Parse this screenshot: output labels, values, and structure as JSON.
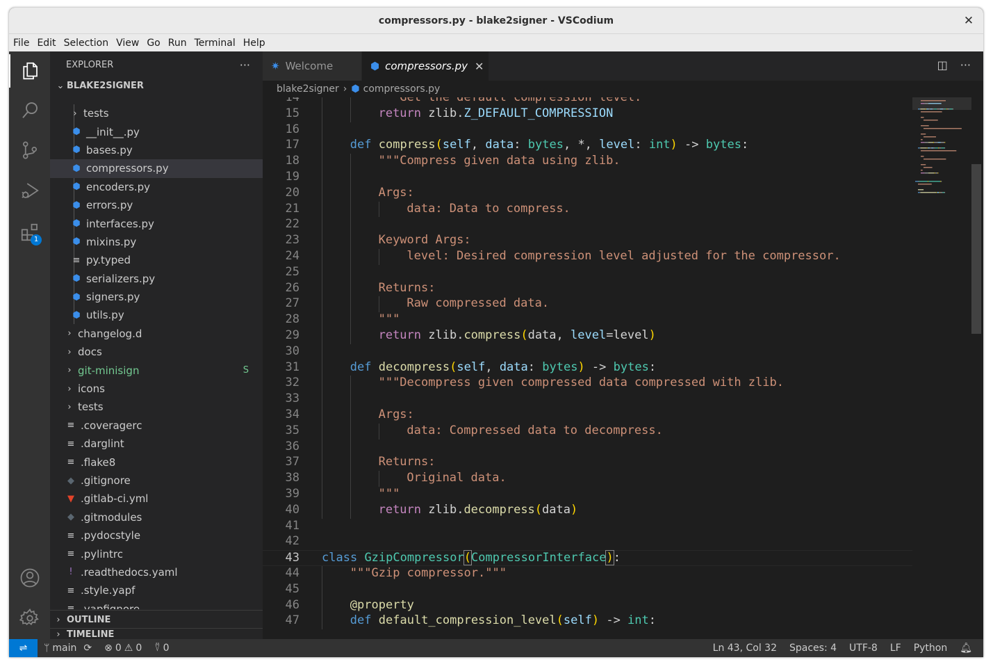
{
  "window": {
    "title": "compressors.py - blake2signer - VSCodium",
    "close_glyph": "✕"
  },
  "menu": [
    "File",
    "Edit",
    "Selection",
    "View",
    "Go",
    "Run",
    "Terminal",
    "Help"
  ],
  "activity_bar": {
    "items": [
      "explorer-icon",
      "search-icon",
      "source-control-icon",
      "run-debug-icon",
      "extensions-icon"
    ],
    "extensions_badge": "1",
    "bottom": [
      "accounts-icon",
      "settings-gear-icon"
    ]
  },
  "sidebar": {
    "header": "EXPLORER",
    "more_glyph": "···",
    "folder": "BLAKE2SIGNER",
    "tree": [
      {
        "label": "tests",
        "type": "folder",
        "indent": 1
      },
      {
        "label": "__init__.py",
        "type": "python",
        "indent": 1
      },
      {
        "label": "bases.py",
        "type": "python",
        "indent": 1
      },
      {
        "label": "compressors.py",
        "type": "python",
        "indent": 1,
        "selected": true
      },
      {
        "label": "encoders.py",
        "type": "python",
        "indent": 1
      },
      {
        "label": "errors.py",
        "type": "python",
        "indent": 1
      },
      {
        "label": "interfaces.py",
        "type": "python",
        "indent": 1
      },
      {
        "label": "mixins.py",
        "type": "python",
        "indent": 1
      },
      {
        "label": "py.typed",
        "type": "text",
        "indent": 1
      },
      {
        "label": "serializers.py",
        "type": "python",
        "indent": 1
      },
      {
        "label": "signers.py",
        "type": "python",
        "indent": 1
      },
      {
        "label": "utils.py",
        "type": "python",
        "indent": 1
      },
      {
        "label": "changelog.d",
        "type": "folder",
        "indent": 0
      },
      {
        "label": "docs",
        "type": "folder",
        "indent": 0
      },
      {
        "label": "git-minisign",
        "type": "folder",
        "indent": 0,
        "decoration": "S",
        "color": "#73c991"
      },
      {
        "label": "icons",
        "type": "folder",
        "indent": 0
      },
      {
        "label": "tests",
        "type": "folder",
        "indent": 0
      },
      {
        "label": ".coveragerc",
        "type": "text",
        "indent": 0
      },
      {
        "label": ".darglint",
        "type": "text",
        "indent": 0
      },
      {
        "label": ".flake8",
        "type": "text",
        "indent": 0
      },
      {
        "label": ".gitignore",
        "type": "git",
        "indent": 0
      },
      {
        "label": ".gitlab-ci.yml",
        "type": "gitlab",
        "indent": 0
      },
      {
        "label": ".gitmodules",
        "type": "git",
        "indent": 0
      },
      {
        "label": ".pydocstyle",
        "type": "text",
        "indent": 0
      },
      {
        "label": ".pylintrc",
        "type": "text",
        "indent": 0
      },
      {
        "label": ".readthedocs.yaml",
        "type": "yaml",
        "indent": 0
      },
      {
        "label": ".style.yapf",
        "type": "text",
        "indent": 0
      },
      {
        "label": ".yapfignore",
        "type": "text",
        "indent": 0
      }
    ],
    "sections": [
      "OUTLINE",
      "TIMELINE"
    ]
  },
  "tabs": [
    {
      "label": "Welcome",
      "active": false
    },
    {
      "label": "compressors.py",
      "active": true
    }
  ],
  "breadcrumb": [
    "blake2signer",
    "compressors.py"
  ],
  "editor": {
    "current_line": 43,
    "lines": [
      {
        "n": 14,
        "i": 2,
        "t": [
          [
            "str",
            "\"\"\"Get the default compression level.\"\"\""
          ]
        ]
      },
      {
        "n": 15,
        "i": 2,
        "t": [
          [
            "ctl",
            "return"
          ],
          [
            "pn",
            " zlib."
          ],
          [
            "param",
            "Z_DEFAULT_COMPRESSION"
          ]
        ]
      },
      {
        "n": 16,
        "i": 0,
        "t": []
      },
      {
        "n": 17,
        "i": 1,
        "t": [
          [
            "kw",
            "def"
          ],
          [
            "pn",
            " "
          ],
          [
            "fn",
            "compress"
          ],
          [
            "br1",
            "("
          ],
          [
            "param",
            "self"
          ],
          [
            "pn",
            ", "
          ],
          [
            "param",
            "data"
          ],
          [
            "pn",
            ": "
          ],
          [
            "cls",
            "bytes"
          ],
          [
            "pn",
            ", *, "
          ],
          [
            "param",
            "level"
          ],
          [
            "pn",
            ": "
          ],
          [
            "cls",
            "int"
          ],
          [
            "br1",
            ")"
          ],
          [
            "pn",
            " -> "
          ],
          [
            "cls",
            "bytes"
          ],
          [
            "pn",
            ":"
          ]
        ]
      },
      {
        "n": 18,
        "i": 2,
        "t": [
          [
            "str",
            "\"\"\"Compress given data using zlib."
          ]
        ]
      },
      {
        "n": 19,
        "i": 0,
        "t": []
      },
      {
        "n": 20,
        "i": 2,
        "t": [
          [
            "str",
            "Args:"
          ]
        ]
      },
      {
        "n": 21,
        "i": 3,
        "t": [
          [
            "str",
            "data: Data to compress."
          ]
        ]
      },
      {
        "n": 22,
        "i": 0,
        "t": []
      },
      {
        "n": 23,
        "i": 2,
        "t": [
          [
            "str",
            "Keyword Args:"
          ]
        ]
      },
      {
        "n": 24,
        "i": 3,
        "t": [
          [
            "str",
            "level: Desired compression level adjusted for the compressor."
          ]
        ]
      },
      {
        "n": 25,
        "i": 0,
        "t": []
      },
      {
        "n": 26,
        "i": 2,
        "t": [
          [
            "str",
            "Returns:"
          ]
        ]
      },
      {
        "n": 27,
        "i": 3,
        "t": [
          [
            "str",
            "Raw compressed data."
          ]
        ]
      },
      {
        "n": 28,
        "i": 2,
        "t": [
          [
            "str",
            "\"\"\""
          ]
        ]
      },
      {
        "n": 29,
        "i": 2,
        "t": [
          [
            "ctl",
            "return"
          ],
          [
            "pn",
            " zlib."
          ],
          [
            "fn",
            "compress"
          ],
          [
            "br1",
            "("
          ],
          [
            "pn",
            "data, "
          ],
          [
            "param",
            "level"
          ],
          [
            "pn",
            "=level"
          ],
          [
            "br1",
            ")"
          ]
        ]
      },
      {
        "n": 30,
        "i": 0,
        "t": []
      },
      {
        "n": 31,
        "i": 1,
        "t": [
          [
            "kw",
            "def"
          ],
          [
            "pn",
            " "
          ],
          [
            "fn",
            "decompress"
          ],
          [
            "br1",
            "("
          ],
          [
            "param",
            "self"
          ],
          [
            "pn",
            ", "
          ],
          [
            "param",
            "data"
          ],
          [
            "pn",
            ": "
          ],
          [
            "cls",
            "bytes"
          ],
          [
            "br1",
            ")"
          ],
          [
            "pn",
            " -> "
          ],
          [
            "cls",
            "bytes"
          ],
          [
            "pn",
            ":"
          ]
        ]
      },
      {
        "n": 32,
        "i": 2,
        "t": [
          [
            "str",
            "\"\"\"Decompress given compressed data compressed with zlib."
          ]
        ]
      },
      {
        "n": 33,
        "i": 0,
        "t": []
      },
      {
        "n": 34,
        "i": 2,
        "t": [
          [
            "str",
            "Args:"
          ]
        ]
      },
      {
        "n": 35,
        "i": 3,
        "t": [
          [
            "str",
            "data: Compressed data to decompress."
          ]
        ]
      },
      {
        "n": 36,
        "i": 0,
        "t": []
      },
      {
        "n": 37,
        "i": 2,
        "t": [
          [
            "str",
            "Returns:"
          ]
        ]
      },
      {
        "n": 38,
        "i": 3,
        "t": [
          [
            "str",
            "Original data."
          ]
        ]
      },
      {
        "n": 39,
        "i": 2,
        "t": [
          [
            "str",
            "\"\"\""
          ]
        ]
      },
      {
        "n": 40,
        "i": 2,
        "t": [
          [
            "ctl",
            "return"
          ],
          [
            "pn",
            " zlib."
          ],
          [
            "fn",
            "decompress"
          ],
          [
            "br1",
            "("
          ],
          [
            "pn",
            "data"
          ],
          [
            "br1",
            ")"
          ]
        ]
      },
      {
        "n": 41,
        "i": 0,
        "t": []
      },
      {
        "n": 42,
        "i": 0,
        "t": []
      },
      {
        "n": 43,
        "i": 0,
        "t": [
          [
            "kw",
            "class"
          ],
          [
            "pn",
            " "
          ],
          [
            "cls",
            "GzipCompressor"
          ],
          [
            "br1",
            "("
          ],
          [
            "cls",
            "CompressorInterface"
          ],
          [
            "br1",
            ")"
          ],
          [
            "pn",
            ":"
          ]
        ]
      },
      {
        "n": 44,
        "i": 1,
        "t": [
          [
            "str",
            "\"\"\"Gzip compressor.\"\"\""
          ]
        ]
      },
      {
        "n": 45,
        "i": 0,
        "t": []
      },
      {
        "n": 46,
        "i": 1,
        "t": [
          [
            "fn",
            "@property"
          ]
        ]
      },
      {
        "n": 47,
        "i": 1,
        "t": [
          [
            "kw",
            "def"
          ],
          [
            "pn",
            " "
          ],
          [
            "fn",
            "default_compression_level"
          ],
          [
            "br1",
            "("
          ],
          [
            "param",
            "self"
          ],
          [
            "br1",
            ")"
          ],
          [
            "pn",
            " -> "
          ],
          [
            "cls",
            "int"
          ],
          [
            "pn",
            ":"
          ]
        ]
      }
    ]
  },
  "status": {
    "branch": "main",
    "errors": "0",
    "warnings": "0",
    "ports": "0",
    "position": "Ln 43, Col 32",
    "spaces": "Spaces: 4",
    "encoding": "UTF-8",
    "eol": "LF",
    "language": "Python"
  },
  "colors": {
    "accent": "#0078d4",
    "python_icon": "#3b8eea",
    "untracked": "#73c991"
  }
}
